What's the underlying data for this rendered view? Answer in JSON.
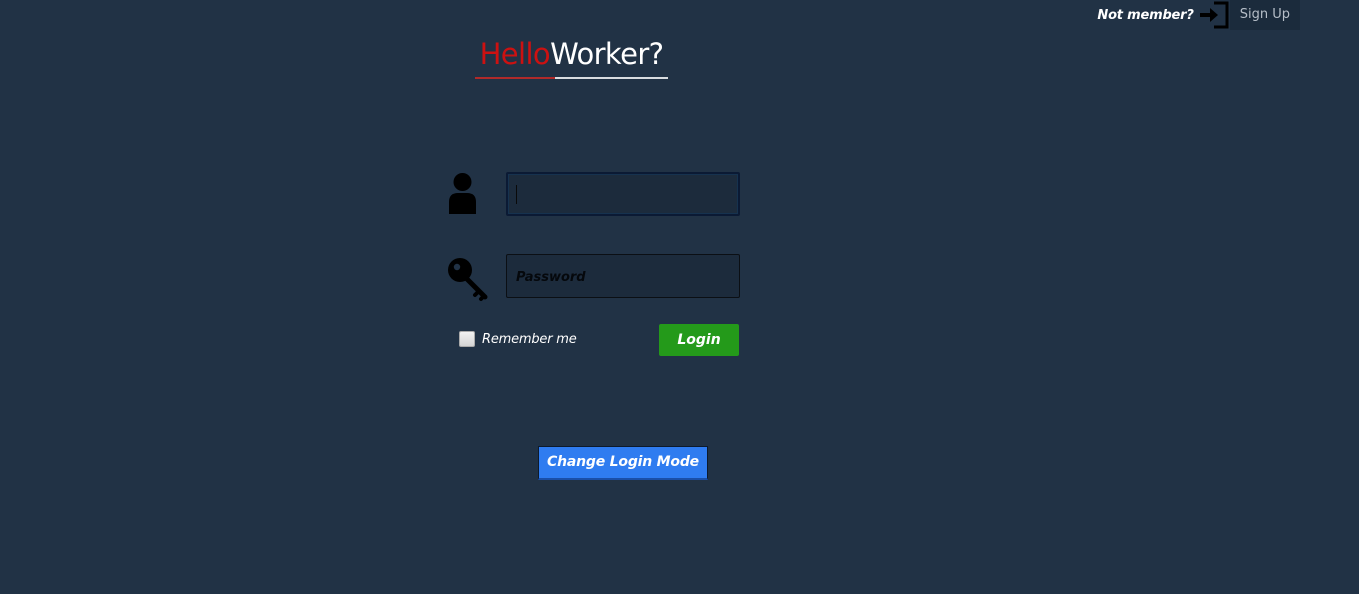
{
  "header": {
    "not_member_text": "Not member?",
    "signup_icon": "sign-in-icon",
    "signup_label": "Sign Up"
  },
  "brand": {
    "hello": "Hello",
    "worker": "Worker?",
    "hello_color": "#cc1111",
    "worker_color": "#ffffff"
  },
  "form": {
    "username_icon": "user-icon",
    "username_value": "",
    "password_icon": "key-icon",
    "password_placeholder": "Password",
    "remember_label": "Remember me",
    "remember_checked": false,
    "login_label": "Login"
  },
  "footer": {
    "change_mode_label": "Change Login Mode"
  },
  "colors": {
    "background": "#213245",
    "login_button": "#249a1a",
    "change_mode_button": "#2f7cf0"
  }
}
